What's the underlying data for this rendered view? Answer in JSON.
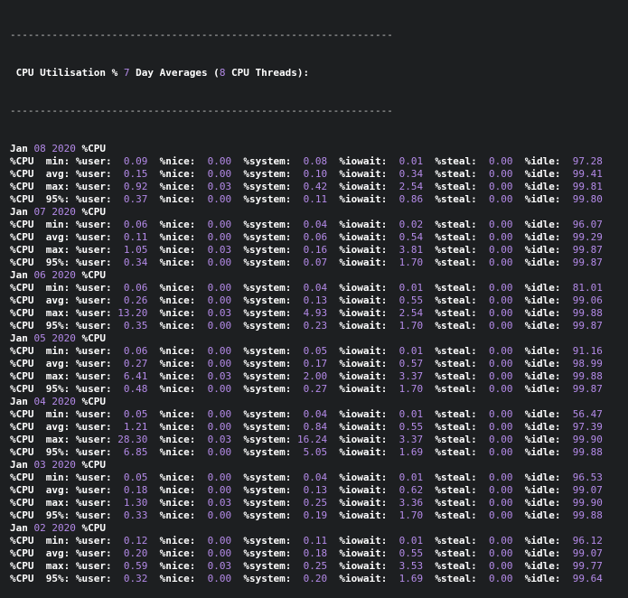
{
  "header": {
    "separator": "----------------------------------------------------------------",
    "title_prefix": " CPU Utilisation ",
    "title_pct": "%",
    "title_mid1": " ",
    "title_num": "7",
    "title_mid2": " Day Averages (",
    "title_threads": "8",
    "title_suffix": " CPU Threads):"
  },
  "days": [
    {
      "month": "Jan",
      "day": "08",
      "year": "2020",
      "label": "%CPU",
      "rows": [
        {
          "stat": "min:",
          "user": "0.09",
          "nice": "0.00",
          "system": "0.08",
          "iowait": "0.01",
          "steal": "0.00",
          "idle": "97.28"
        },
        {
          "stat": "avg:",
          "user": "0.15",
          "nice": "0.00",
          "system": "0.10",
          "iowait": "0.34",
          "steal": "0.00",
          "idle": "99.41"
        },
        {
          "stat": "max:",
          "user": "0.92",
          "nice": "0.03",
          "system": "0.42",
          "iowait": "2.54",
          "steal": "0.00",
          "idle": "99.81"
        },
        {
          "stat": "95%:",
          "user": "0.37",
          "nice": "0.00",
          "system": "0.11",
          "iowait": "0.86",
          "steal": "0.00",
          "idle": "99.80"
        }
      ]
    },
    {
      "month": "Jan",
      "day": "07",
      "year": "2020",
      "label": "%CPU",
      "rows": [
        {
          "stat": "min:",
          "user": "0.06",
          "nice": "0.00",
          "system": "0.04",
          "iowait": "0.02",
          "steal": "0.00",
          "idle": "96.07"
        },
        {
          "stat": "avg:",
          "user": "0.11",
          "nice": "0.00",
          "system": "0.06",
          "iowait": "0.54",
          "steal": "0.00",
          "idle": "99.29"
        },
        {
          "stat": "max:",
          "user": "1.05",
          "nice": "0.03",
          "system": "0.16",
          "iowait": "3.81",
          "steal": "0.00",
          "idle": "99.87"
        },
        {
          "stat": "95%:",
          "user": "0.34",
          "nice": "0.00",
          "system": "0.07",
          "iowait": "1.70",
          "steal": "0.00",
          "idle": "99.87"
        }
      ]
    },
    {
      "month": "Jan",
      "day": "06",
      "year": "2020",
      "label": "%CPU",
      "rows": [
        {
          "stat": "min:",
          "user": "0.06",
          "nice": "0.00",
          "system": "0.04",
          "iowait": "0.01",
          "steal": "0.00",
          "idle": "81.01"
        },
        {
          "stat": "avg:",
          "user": "0.26",
          "nice": "0.00",
          "system": "0.13",
          "iowait": "0.55",
          "steal": "0.00",
          "idle": "99.06"
        },
        {
          "stat": "max:",
          "user": "13.20",
          "nice": "0.03",
          "system": "4.93",
          "iowait": "2.54",
          "steal": "0.00",
          "idle": "99.88"
        },
        {
          "stat": "95%:",
          "user": "0.35",
          "nice": "0.00",
          "system": "0.23",
          "iowait": "1.70",
          "steal": "0.00",
          "idle": "99.87"
        }
      ]
    },
    {
      "month": "Jan",
      "day": "05",
      "year": "2020",
      "label": "%CPU",
      "rows": [
        {
          "stat": "min:",
          "user": "0.06",
          "nice": "0.00",
          "system": "0.05",
          "iowait": "0.01",
          "steal": "0.00",
          "idle": "91.16"
        },
        {
          "stat": "avg:",
          "user": "0.27",
          "nice": "0.00",
          "system": "0.17",
          "iowait": "0.57",
          "steal": "0.00",
          "idle": "98.99"
        },
        {
          "stat": "max:",
          "user": "6.41",
          "nice": "0.03",
          "system": "2.00",
          "iowait": "3.37",
          "steal": "0.00",
          "idle": "99.88"
        },
        {
          "stat": "95%:",
          "user": "0.48",
          "nice": "0.00",
          "system": "0.27",
          "iowait": "1.70",
          "steal": "0.00",
          "idle": "99.87"
        }
      ]
    },
    {
      "month": "Jan",
      "day": "04",
      "year": "2020",
      "label": "%CPU",
      "rows": [
        {
          "stat": "min:",
          "user": "0.05",
          "nice": "0.00",
          "system": "0.04",
          "iowait": "0.01",
          "steal": "0.00",
          "idle": "56.47"
        },
        {
          "stat": "avg:",
          "user": "1.21",
          "nice": "0.00",
          "system": "0.84",
          "iowait": "0.55",
          "steal": "0.00",
          "idle": "97.39"
        },
        {
          "stat": "max:",
          "user": "28.30",
          "nice": "0.03",
          "system": "16.24",
          "iowait": "3.37",
          "steal": "0.00",
          "idle": "99.90"
        },
        {
          "stat": "95%:",
          "user": "6.85",
          "nice": "0.00",
          "system": "5.05",
          "iowait": "1.69",
          "steal": "0.00",
          "idle": "99.88"
        }
      ]
    },
    {
      "month": "Jan",
      "day": "03",
      "year": "2020",
      "label": "%CPU",
      "rows": [
        {
          "stat": "min:",
          "user": "0.05",
          "nice": "0.00",
          "system": "0.04",
          "iowait": "0.01",
          "steal": "0.00",
          "idle": "96.53"
        },
        {
          "stat": "avg:",
          "user": "0.18",
          "nice": "0.00",
          "system": "0.13",
          "iowait": "0.62",
          "steal": "0.00",
          "idle": "99.07"
        },
        {
          "stat": "max:",
          "user": "1.30",
          "nice": "0.03",
          "system": "0.25",
          "iowait": "3.36",
          "steal": "0.00",
          "idle": "99.90"
        },
        {
          "stat": "95%:",
          "user": "0.33",
          "nice": "0.00",
          "system": "0.19",
          "iowait": "1.70",
          "steal": "0.00",
          "idle": "99.88"
        }
      ]
    },
    {
      "month": "Jan",
      "day": "02",
      "year": "2020",
      "label": "%CPU",
      "rows": [
        {
          "stat": "min:",
          "user": "0.12",
          "nice": "0.00",
          "system": "0.11",
          "iowait": "0.01",
          "steal": "0.00",
          "idle": "96.12"
        },
        {
          "stat": "avg:",
          "user": "0.20",
          "nice": "0.00",
          "system": "0.18",
          "iowait": "0.55",
          "steal": "0.00",
          "idle": "99.07"
        },
        {
          "stat": "max:",
          "user": "0.59",
          "nice": "0.03",
          "system": "0.25",
          "iowait": "3.53",
          "steal": "0.00",
          "idle": "99.77"
        },
        {
          "stat": "95%:",
          "user": "0.32",
          "nice": "0.00",
          "system": "0.20",
          "iowait": "1.69",
          "steal": "0.00",
          "idle": "99.64"
        }
      ]
    }
  ]
}
